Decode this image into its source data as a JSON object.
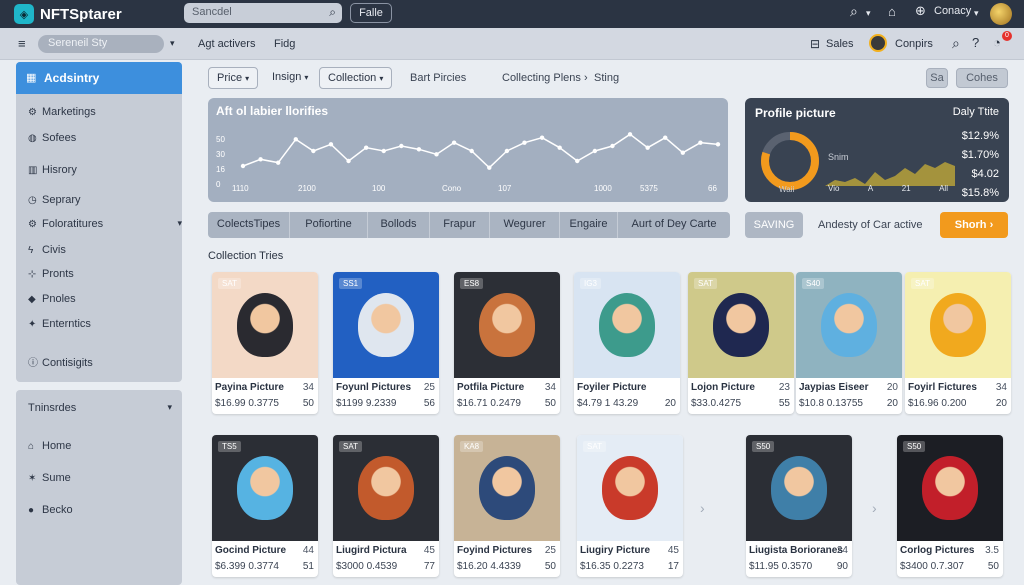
{
  "app": {
    "name": "NFTSptarer",
    "logo_icon": "logo-icon"
  },
  "topbar": {
    "search_placeholder": "Sancdel",
    "filter_label": "Falle",
    "right": {
      "company": "Conacy"
    }
  },
  "subbar": {
    "select": "Sereneil Sty",
    "links": [
      "Agt activers",
      "Fidg"
    ],
    "sales": "Sales",
    "compars": "Conpirs",
    "notif_count": "0"
  },
  "sidebar": {
    "header": "Acdsintry",
    "items": [
      "Marketings",
      "Sofees",
      "Hisrory",
      "Seprary",
      "Foloratitures",
      "Civis",
      "Pronts",
      "Pnoles",
      "Enterntics",
      "Contisigits"
    ],
    "section2_title": "Tninsrdes",
    "items2": [
      "Home",
      "Sume",
      "Becko"
    ]
  },
  "filters": {
    "chips": [
      "Price",
      "Insign",
      "Collection"
    ],
    "links": [
      "Bart Pircies",
      "Collecting Plens",
      "Sting"
    ],
    "right_buttons": [
      "Sa",
      "Cohes"
    ]
  },
  "chart_data": {
    "type": "line",
    "title": "Aft ol labier llorifies",
    "y_ticks": [
      "50",
      "30",
      "16",
      "0"
    ],
    "x_ticks": [
      "1110",
      "2100",
      "100",
      "Cono",
      "107",
      "1000",
      "5375",
      "66"
    ],
    "values": [
      11,
      15,
      13,
      27,
      20,
      24,
      14,
      22,
      20,
      23,
      21,
      18,
      25,
      20,
      10,
      20,
      25,
      28,
      22,
      14,
      20,
      23,
      30,
      22,
      28,
      19,
      25,
      24
    ]
  },
  "profile_panel": {
    "title": "Profile picture",
    "daily": "Daly Ttite",
    "mid_label": "Snim",
    "donut_label": "Waii",
    "values": [
      "$12.9%",
      "$1.70%",
      "$4.02",
      "$15.8%"
    ],
    "axis": [
      "Vio",
      "A",
      "21",
      "All"
    ],
    "donut_fraction": 0.8
  },
  "tabs": [
    "ColectsTipes",
    "Pofiortine",
    "Bollods",
    "Frapur",
    "Wegurer",
    "Engaire",
    "Aurt of Dey Carte"
  ],
  "actions": {
    "saving": "SAVING",
    "status": "Andesty of Car active",
    "primary": "Shorh"
  },
  "section_title": "Collection Tries",
  "cards_row1": [
    {
      "badge": "SAT",
      "name": "Payina Picture",
      "n1": "34",
      "price": "$16.99 0.3775",
      "n2": "50",
      "bg": "#f3d9c6",
      "face": "#2a2a30"
    },
    {
      "badge": "SS1",
      "name": "Foyunl Pictures",
      "n1": "25",
      "price": "$1199 9.2339",
      "n2": "56",
      "bg": "#2260c2",
      "face": "#dfe6ef"
    },
    {
      "badge": "ES8",
      "name": "Potfila Picture",
      "n1": "34",
      "price": "$16.71 0.2479",
      "n2": "50",
      "bg": "#2c2f36",
      "face": "#c9733d"
    },
    {
      "badge": "IG3",
      "name": "Foyiler Picture",
      "n1": "",
      "price": "$4.79 1 43.29",
      "n2": "20",
      "bg": "#d8e4f2",
      "face": "#3d9b8c"
    },
    {
      "badge": "SAT",
      "name": "Lojon Picture",
      "n1": "23",
      "price": "$33.0.4275",
      "n2": "55",
      "bg": "#cfc98a",
      "face": "#1f2850"
    },
    {
      "badge": "S40",
      "name": "Jaypias Eiseer",
      "n1": "20",
      "price": "$10.8 0.13755",
      "n2": "20",
      "bg": "#8fb3c0",
      "face": "#5fb0e0"
    },
    {
      "badge": "SAT",
      "name": "Foyirl Fictures",
      "n1": "34",
      "price": "$16.96 0.200",
      "n2": "20",
      "bg": "#f5efb0",
      "face": "#f1a91e"
    }
  ],
  "cards_row2": [
    {
      "badge": "TS5",
      "name": "Gocind Picture",
      "n1": "44",
      "price": "$6.399 0.3774",
      "n2": "51",
      "bg": "#2b2e35",
      "face": "#56b3e2"
    },
    {
      "badge": "SAT",
      "name": "Liugird Pictura",
      "n1": "45",
      "price": "$3000 0.4539",
      "n2": "77",
      "bg": "#2b2e35",
      "face": "#c25a2c"
    },
    {
      "badge": "KA8",
      "name": "Foyind Pictures",
      "n1": "25",
      "price": "$16.20 4.4339",
      "n2": "50",
      "bg": "#c7b396",
      "face": "#2d4a7a"
    },
    {
      "badge": "SAT",
      "name": "Liugiry Picture",
      "n1": "45",
      "price": "$16.35 0.2273",
      "n2": "17",
      "bg": "#e4ecf5",
      "face": "#c93a2a"
    },
    {
      "badge": "S50",
      "name": "Liugista Borioranes",
      "n1": "24",
      "price": "$11.95 0.3570",
      "n2": "90",
      "bg": "#2b2e35",
      "face": "#3f7fa8"
    },
    {
      "badge": "S50",
      "name": "Corlog Pictures",
      "n1": "3.5",
      "price": "$3400 0.7.307",
      "n2": "50",
      "bg": "#1c1e24",
      "face": "#c21f2a"
    }
  ]
}
